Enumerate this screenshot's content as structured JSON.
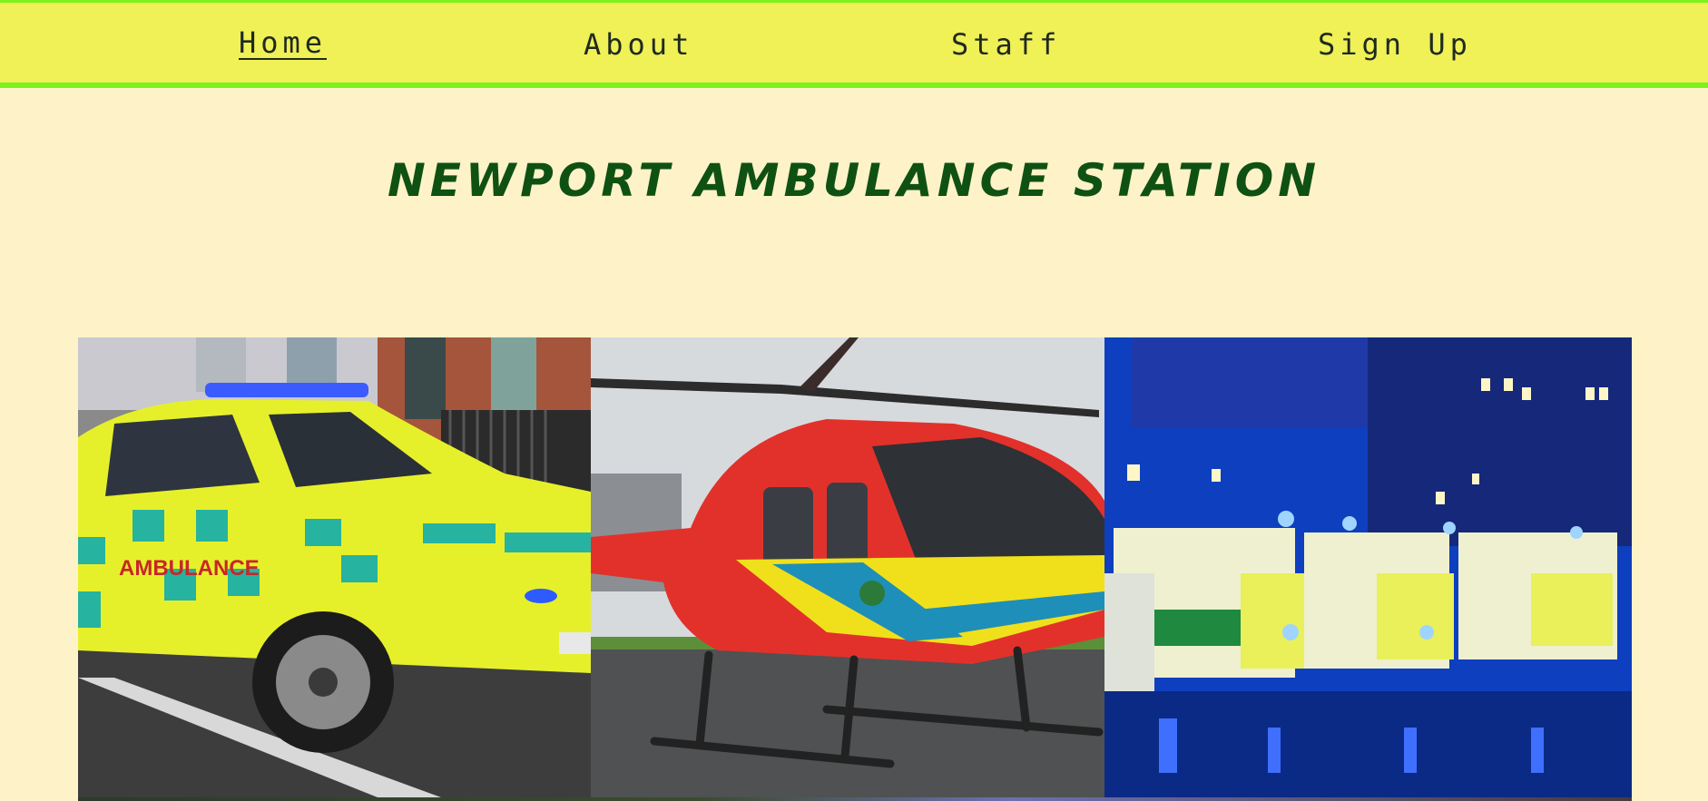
{
  "nav": {
    "items": [
      {
        "label": "Home",
        "active": true
      },
      {
        "label": "About",
        "active": false
      },
      {
        "label": "Staff",
        "active": false
      },
      {
        "label": "Sign Up",
        "active": false
      }
    ]
  },
  "header": {
    "title": "NEWPORT AMBULANCE STATION"
  },
  "gallery": {
    "photos": [
      {
        "subject": "ambulance-car",
        "badge_text": "AMBULANCE"
      },
      {
        "subject": "air-ambulance-helicopter"
      },
      {
        "subject": "ambulance-fleet-night"
      }
    ]
  },
  "colors": {
    "page_background": "#fdf2c8",
    "nav_background": "#f0f057",
    "nav_border": "#7cf21d",
    "title": "#0f5112",
    "nav_text": "#1f2a1f"
  }
}
